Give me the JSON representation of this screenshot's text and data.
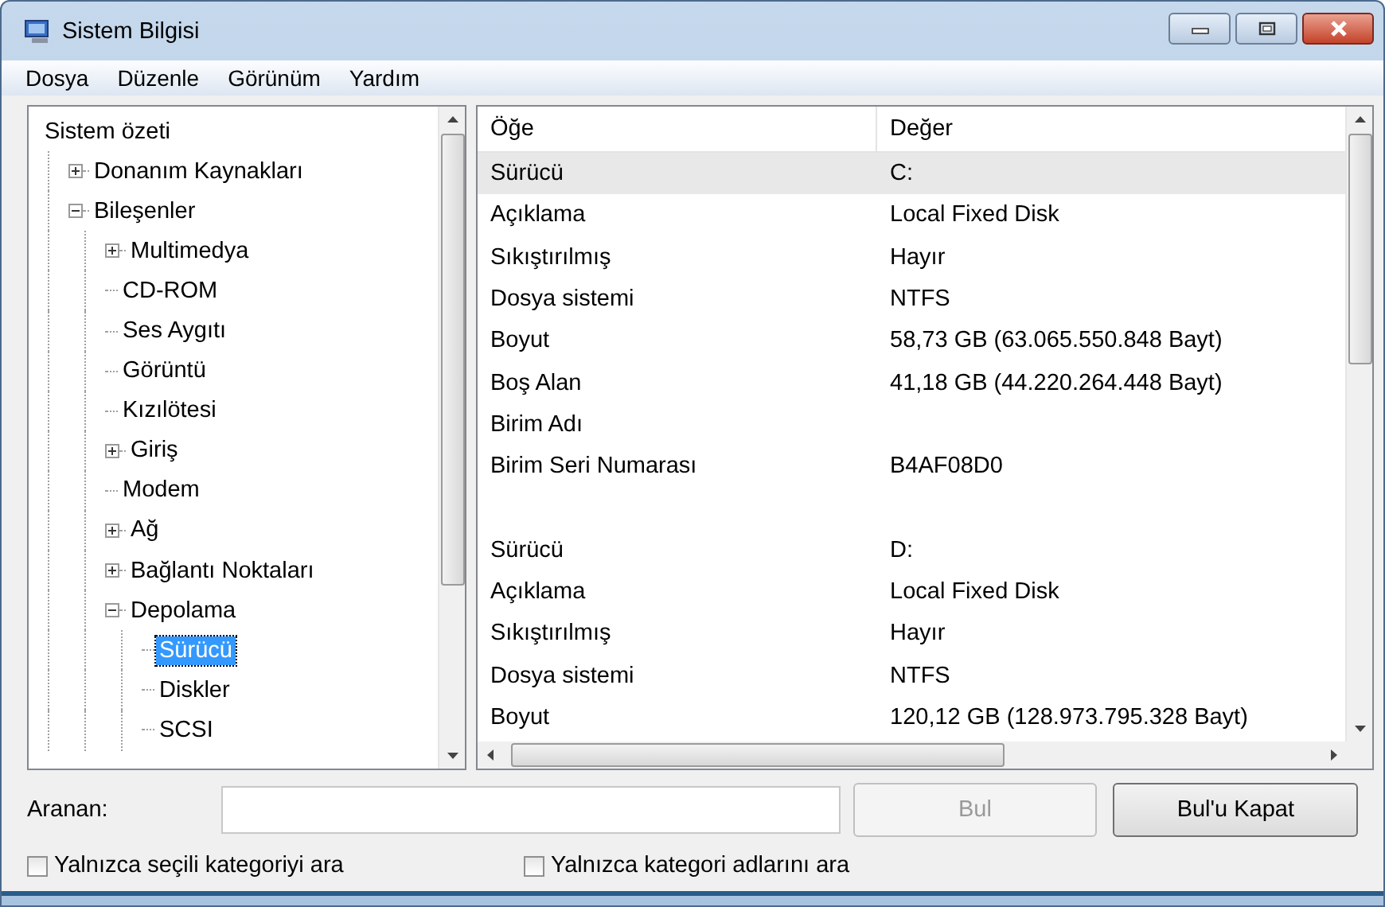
{
  "window": {
    "title": "Sistem Bilgisi"
  },
  "menu": [
    "Dosya",
    "Düzenle",
    "Görünüm",
    "Yardım"
  ],
  "tree": [
    {
      "label": "Sistem özeti",
      "kind": "root",
      "selected": false,
      "children": [
        {
          "label": "Donanım Kaynakları",
          "kind": "group",
          "expanded": false,
          "selected": false
        },
        {
          "label": "Bileşenler",
          "kind": "group",
          "expanded": true,
          "selected": false,
          "children": [
            {
              "label": "Multimedya",
              "kind": "group",
              "expanded": false,
              "selected": false
            },
            {
              "label": "CD-ROM",
              "kind": "leaf",
              "selected": false
            },
            {
              "label": "Ses Aygıtı",
              "kind": "leaf",
              "selected": false
            },
            {
              "label": "Görüntü",
              "kind": "leaf",
              "selected": false
            },
            {
              "label": "Kızılötesi",
              "kind": "leaf",
              "selected": false
            },
            {
              "label": "Giriş",
              "kind": "group",
              "expanded": false,
              "selected": false
            },
            {
              "label": "Modem",
              "kind": "leaf",
              "selected": false
            },
            {
              "label": "Ağ",
              "kind": "group",
              "expanded": false,
              "selected": false
            },
            {
              "label": "Bağlantı Noktaları",
              "kind": "group",
              "expanded": false,
              "selected": false
            },
            {
              "label": "Depolama",
              "kind": "group",
              "expanded": true,
              "selected": false,
              "children": [
                {
                  "label": "Sürücü",
                  "kind": "leaf",
                  "selected": true
                },
                {
                  "label": "Diskler",
                  "kind": "leaf",
                  "selected": false
                },
                {
                  "label": "SCSI",
                  "kind": "leaf",
                  "selected": false
                }
              ]
            }
          ]
        }
      ]
    }
  ],
  "table": {
    "columns": [
      "Öğe",
      "Değer"
    ],
    "rows": [
      {
        "kind": "data",
        "item": "Sürücü",
        "value": "C:",
        "selected": true
      },
      {
        "kind": "data",
        "item": "Açıklama",
        "value": "Local Fixed Disk",
        "selected": false
      },
      {
        "kind": "data",
        "item": "Sıkıştırılmış",
        "value": "Hayır",
        "selected": false
      },
      {
        "kind": "data",
        "item": "Dosya sistemi",
        "value": "NTFS",
        "selected": false
      },
      {
        "kind": "data",
        "item": "Boyut",
        "value": "58,73 GB (63.065.550.848 Bayt)",
        "selected": false
      },
      {
        "kind": "data",
        "item": "Boş Alan",
        "value": "41,18 GB (44.220.264.448 Bayt)",
        "selected": false
      },
      {
        "kind": "data",
        "item": "Birim Adı",
        "selected": false
      },
      {
        "kind": "data",
        "item": "Birim Seri Numarası",
        "value": "B4AF08D0",
        "selected": false
      },
      {
        "kind": "spacer"
      },
      {
        "kind": "data",
        "item": "Sürücü",
        "value": "D:",
        "selected": false
      },
      {
        "kind": "data",
        "item": "Açıklama",
        "value": "Local Fixed Disk",
        "selected": false
      },
      {
        "kind": "data",
        "item": "Sıkıştırılmış",
        "value": "Hayır",
        "selected": false
      },
      {
        "kind": "data",
        "item": "Dosya sistemi",
        "value": "NTFS",
        "selected": false
      },
      {
        "kind": "data",
        "item": "Boyut",
        "value": "120,12 GB (128.973.795.328 Bayt)",
        "selected": false
      }
    ]
  },
  "search": {
    "label": "Aranan:",
    "find_button": {
      "label": "Bul",
      "disabled": true
    },
    "close_button": {
      "label": "Bul'u Kapat",
      "disabled": false
    }
  },
  "options": [
    {
      "label": "Yalnızca seçili kategoriyi ara",
      "checked": false
    },
    {
      "label": "Yalnızca kategori adlarını ara",
      "checked": false
    }
  ]
}
